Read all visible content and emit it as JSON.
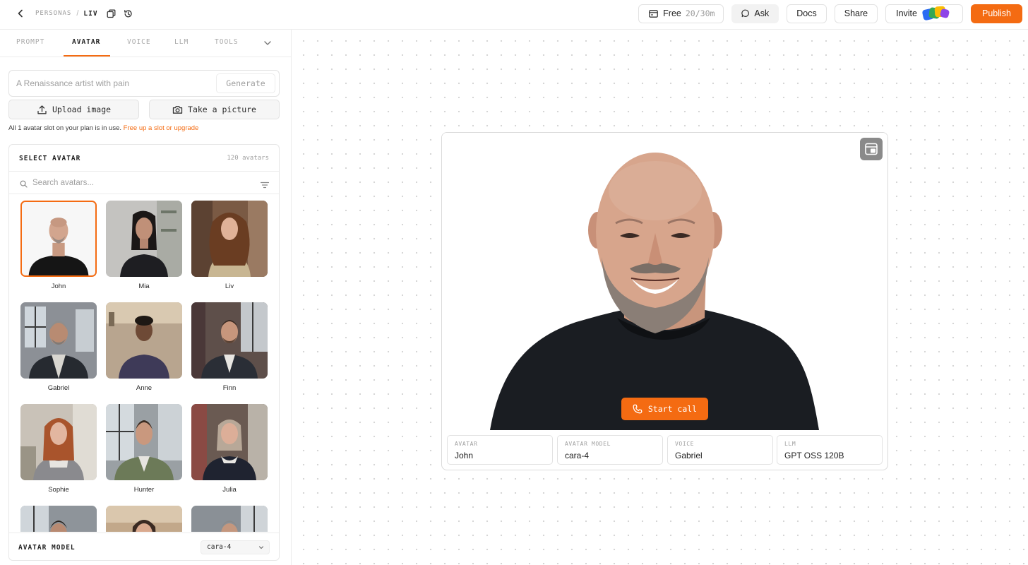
{
  "breadcrumb": {
    "parent": "PERSONAS",
    "separator": "/",
    "current": "LIV"
  },
  "topbar": {
    "free_label": "Free",
    "free_quota": "20/30m",
    "ask_label": "Ask",
    "docs_label": "Docs",
    "share_label": "Share",
    "invite_label": "Invite",
    "publish_label": "Publish"
  },
  "tabs": [
    {
      "label": "PROMPT",
      "active": false
    },
    {
      "label": "AVATAR",
      "active": true
    },
    {
      "label": "VOICE",
      "active": false
    },
    {
      "label": "LLM",
      "active": false
    },
    {
      "label": "TOOLS",
      "active": false
    }
  ],
  "generate": {
    "placeholder": "A Renaissance artist with pain",
    "button_label": "Generate"
  },
  "upload_label": "Upload image",
  "picture_label": "Take a picture",
  "slot_note": {
    "text": "All 1 avatar slot on your plan is in use.",
    "link": "Free up a slot or upgrade"
  },
  "avatar_panel": {
    "title": "SELECT AVATAR",
    "count": "120 avatars",
    "search_placeholder": "Search avatars...",
    "avatars": [
      {
        "name": "John",
        "selected": true
      },
      {
        "name": "Mia",
        "selected": false
      },
      {
        "name": "Liv",
        "selected": false
      },
      {
        "name": "Gabriel",
        "selected": false
      },
      {
        "name": "Anne",
        "selected": false
      },
      {
        "name": "Finn",
        "selected": false
      },
      {
        "name": "Sophie",
        "selected": false
      },
      {
        "name": "Hunter",
        "selected": false
      },
      {
        "name": "Julia",
        "selected": false
      },
      {
        "name": "",
        "selected": false
      },
      {
        "name": "",
        "selected": false
      },
      {
        "name": "",
        "selected": false
      }
    ],
    "model_title": "AVATAR MODEL",
    "model_value": "cara-4"
  },
  "preview": {
    "start_call_label": "Start call",
    "meta": [
      {
        "label": "AVATAR",
        "value": "John"
      },
      {
        "label": "AVATAR MODEL",
        "value": "cara-4"
      },
      {
        "label": "VOICE",
        "value": "Gabriel"
      },
      {
        "label": "LLM",
        "value": "GPT OSS 120B"
      }
    ]
  },
  "colors": {
    "accent": "#f46b12",
    "border": "#e2e2e2",
    "muted": "#a0a0a0"
  },
  "icons": [
    "chevron-left-icon",
    "copy-icon",
    "history-icon",
    "clock-card-icon",
    "chat-bubble-icon",
    "chevron-down-icon",
    "upload-icon",
    "camera-icon",
    "search-icon",
    "filter-icon",
    "expand-icon",
    "phone-icon"
  ]
}
